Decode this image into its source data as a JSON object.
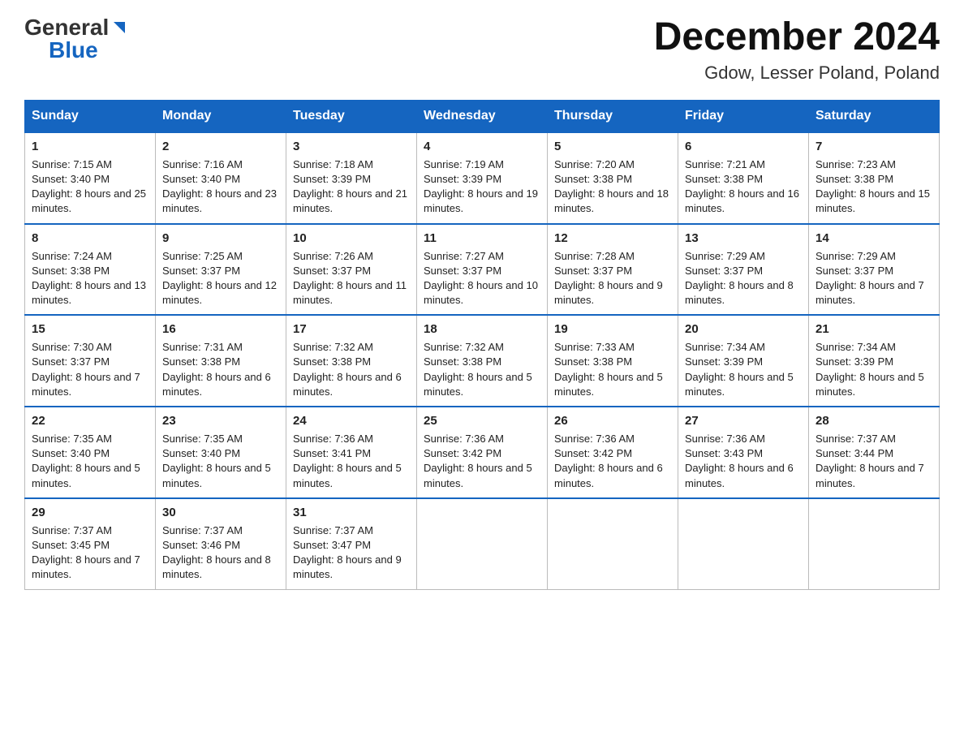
{
  "logo": {
    "general": "General",
    "blue": "Blue"
  },
  "header": {
    "month": "December 2024",
    "location": "Gdow, Lesser Poland, Poland"
  },
  "days_of_week": [
    "Sunday",
    "Monday",
    "Tuesday",
    "Wednesday",
    "Thursday",
    "Friday",
    "Saturday"
  ],
  "weeks": [
    [
      {
        "num": "1",
        "sunrise": "7:15 AM",
        "sunset": "3:40 PM",
        "daylight": "8 hours and 25 minutes."
      },
      {
        "num": "2",
        "sunrise": "7:16 AM",
        "sunset": "3:40 PM",
        "daylight": "8 hours and 23 minutes."
      },
      {
        "num": "3",
        "sunrise": "7:18 AM",
        "sunset": "3:39 PM",
        "daylight": "8 hours and 21 minutes."
      },
      {
        "num": "4",
        "sunrise": "7:19 AM",
        "sunset": "3:39 PM",
        "daylight": "8 hours and 19 minutes."
      },
      {
        "num": "5",
        "sunrise": "7:20 AM",
        "sunset": "3:38 PM",
        "daylight": "8 hours and 18 minutes."
      },
      {
        "num": "6",
        "sunrise": "7:21 AM",
        "sunset": "3:38 PM",
        "daylight": "8 hours and 16 minutes."
      },
      {
        "num": "7",
        "sunrise": "7:23 AM",
        "sunset": "3:38 PM",
        "daylight": "8 hours and 15 minutes."
      }
    ],
    [
      {
        "num": "8",
        "sunrise": "7:24 AM",
        "sunset": "3:38 PM",
        "daylight": "8 hours and 13 minutes."
      },
      {
        "num": "9",
        "sunrise": "7:25 AM",
        "sunset": "3:37 PM",
        "daylight": "8 hours and 12 minutes."
      },
      {
        "num": "10",
        "sunrise": "7:26 AM",
        "sunset": "3:37 PM",
        "daylight": "8 hours and 11 minutes."
      },
      {
        "num": "11",
        "sunrise": "7:27 AM",
        "sunset": "3:37 PM",
        "daylight": "8 hours and 10 minutes."
      },
      {
        "num": "12",
        "sunrise": "7:28 AM",
        "sunset": "3:37 PM",
        "daylight": "8 hours and 9 minutes."
      },
      {
        "num": "13",
        "sunrise": "7:29 AM",
        "sunset": "3:37 PM",
        "daylight": "8 hours and 8 minutes."
      },
      {
        "num": "14",
        "sunrise": "7:29 AM",
        "sunset": "3:37 PM",
        "daylight": "8 hours and 7 minutes."
      }
    ],
    [
      {
        "num": "15",
        "sunrise": "7:30 AM",
        "sunset": "3:37 PM",
        "daylight": "8 hours and 7 minutes."
      },
      {
        "num": "16",
        "sunrise": "7:31 AM",
        "sunset": "3:38 PM",
        "daylight": "8 hours and 6 minutes."
      },
      {
        "num": "17",
        "sunrise": "7:32 AM",
        "sunset": "3:38 PM",
        "daylight": "8 hours and 6 minutes."
      },
      {
        "num": "18",
        "sunrise": "7:32 AM",
        "sunset": "3:38 PM",
        "daylight": "8 hours and 5 minutes."
      },
      {
        "num": "19",
        "sunrise": "7:33 AM",
        "sunset": "3:38 PM",
        "daylight": "8 hours and 5 minutes."
      },
      {
        "num": "20",
        "sunrise": "7:34 AM",
        "sunset": "3:39 PM",
        "daylight": "8 hours and 5 minutes."
      },
      {
        "num": "21",
        "sunrise": "7:34 AM",
        "sunset": "3:39 PM",
        "daylight": "8 hours and 5 minutes."
      }
    ],
    [
      {
        "num": "22",
        "sunrise": "7:35 AM",
        "sunset": "3:40 PM",
        "daylight": "8 hours and 5 minutes."
      },
      {
        "num": "23",
        "sunrise": "7:35 AM",
        "sunset": "3:40 PM",
        "daylight": "8 hours and 5 minutes."
      },
      {
        "num": "24",
        "sunrise": "7:36 AM",
        "sunset": "3:41 PM",
        "daylight": "8 hours and 5 minutes."
      },
      {
        "num": "25",
        "sunrise": "7:36 AM",
        "sunset": "3:42 PM",
        "daylight": "8 hours and 5 minutes."
      },
      {
        "num": "26",
        "sunrise": "7:36 AM",
        "sunset": "3:42 PM",
        "daylight": "8 hours and 6 minutes."
      },
      {
        "num": "27",
        "sunrise": "7:36 AM",
        "sunset": "3:43 PM",
        "daylight": "8 hours and 6 minutes."
      },
      {
        "num": "28",
        "sunrise": "7:37 AM",
        "sunset": "3:44 PM",
        "daylight": "8 hours and 7 minutes."
      }
    ],
    [
      {
        "num": "29",
        "sunrise": "7:37 AM",
        "sunset": "3:45 PM",
        "daylight": "8 hours and 7 minutes."
      },
      {
        "num": "30",
        "sunrise": "7:37 AM",
        "sunset": "3:46 PM",
        "daylight": "8 hours and 8 minutes."
      },
      {
        "num": "31",
        "sunrise": "7:37 AM",
        "sunset": "3:47 PM",
        "daylight": "8 hours and 9 minutes."
      },
      null,
      null,
      null,
      null
    ]
  ],
  "labels": {
    "sunrise": "Sunrise:",
    "sunset": "Sunset:",
    "daylight": "Daylight:"
  }
}
